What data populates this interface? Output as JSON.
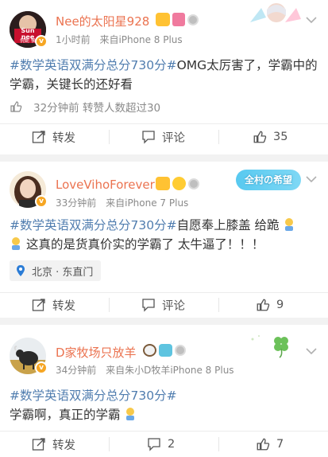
{
  "posts": [
    {
      "user": "Nee的太阳星928",
      "time": "1小时前",
      "source": "来自iPhone 8 Plus",
      "hashtag": "#数学英语双满分总分730分#",
      "text_after_tag": "OMG太厉害了，学霸中的学霸，关键长的还好看",
      "stats": "32分钟前 转赞人数超过30",
      "actions": {
        "repost": "转发",
        "comment": "评论",
        "like": "35"
      },
      "avatar_text": "Sun nee",
      "avatar_subtext": "倪妮 侯"
    },
    {
      "user": "LoveVihoForever",
      "time": "33分钟前",
      "source": "来自iPhone 7 Plus",
      "hashtag": "#数学英语双满分总分730分#",
      "text_after_tag": "自愿奉上膝盖 给跪",
      "text_line2": "这真的是货真价实的学霸了 太牛逼了！！！",
      "location": "北京 · 东直门",
      "badge_text": "全村の希望",
      "actions": {
        "repost": "转发",
        "comment": "评论",
        "like": "9"
      }
    },
    {
      "user": "D家牧场只放羊",
      "time": "34分钟前",
      "source": "来自朱小D牧羊iPhone 8 Plus",
      "hashtag": "#数学英语双满分总分730分#",
      "text_line2": "学霸啊，真正的学霸",
      "actions": {
        "repost": "转发",
        "comment": "2",
        "like": "7"
      }
    }
  ],
  "colors": {
    "username": "#eb7350",
    "hashtag": "#507daf",
    "vip": "#f6a623",
    "location": "#2b7cd6"
  },
  "icons": [
    "chevron-down-icon",
    "verified-icon",
    "like-icon",
    "repost-icon",
    "comment-icon",
    "location-icon",
    "kneel-emoji-icon"
  ]
}
